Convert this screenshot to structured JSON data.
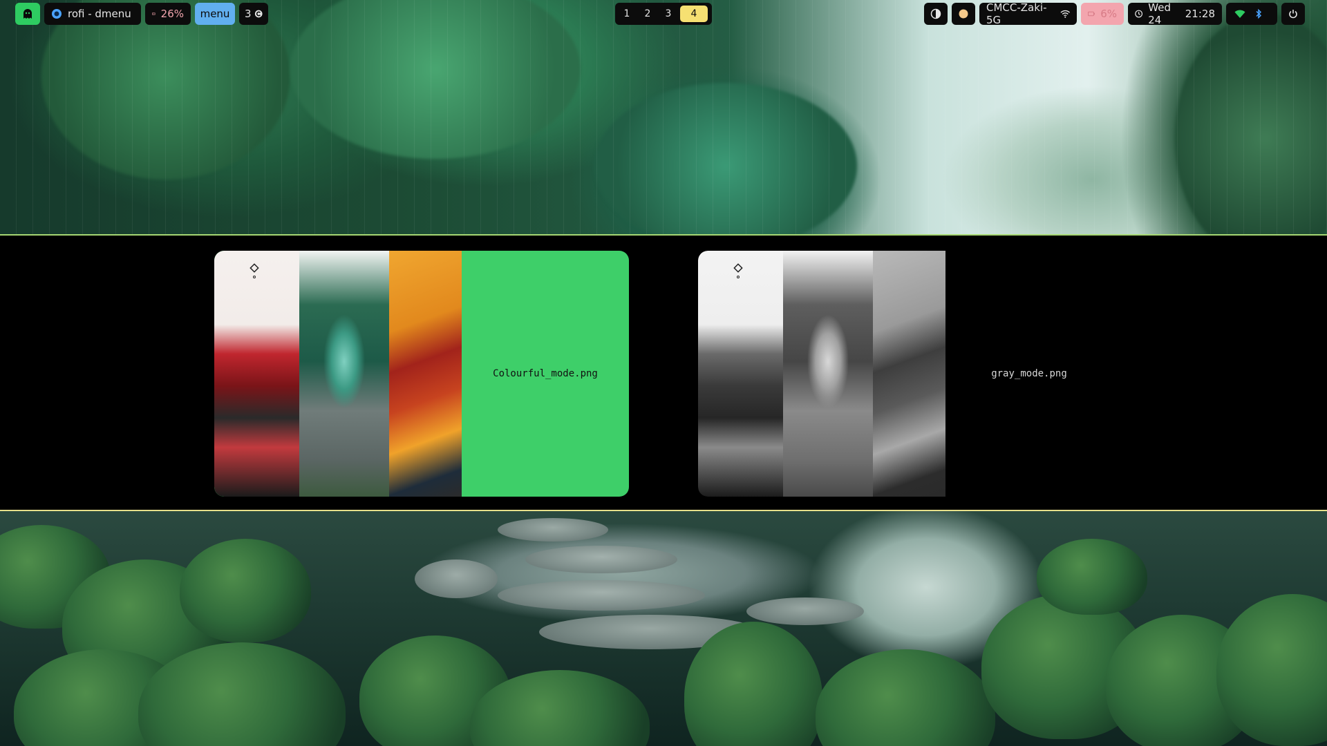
{
  "topbar": {
    "left": {
      "window_title": "rofi - dmenu",
      "memory": "26%",
      "menu_label": "menu",
      "notifications": "3"
    },
    "workspaces": [
      "1",
      "2",
      "3",
      "4"
    ],
    "active_workspace": "4",
    "right": {
      "wifi_name": "CMCC-Zaki-5G",
      "battery": "6%",
      "date": "Wed 24",
      "time": "21:28"
    }
  },
  "rofi": {
    "entries": [
      {
        "label": "Colourful_mode.png",
        "selected": true
      },
      {
        "label": "gray_mode.png",
        "selected": false
      }
    ]
  },
  "colors": {
    "accent_green": "#2ecc61",
    "selected_entry": "#3ecf69",
    "menu_blue": "#61afef",
    "active_workspace": "#f6e072",
    "battery_low": "#f3a5ae"
  }
}
